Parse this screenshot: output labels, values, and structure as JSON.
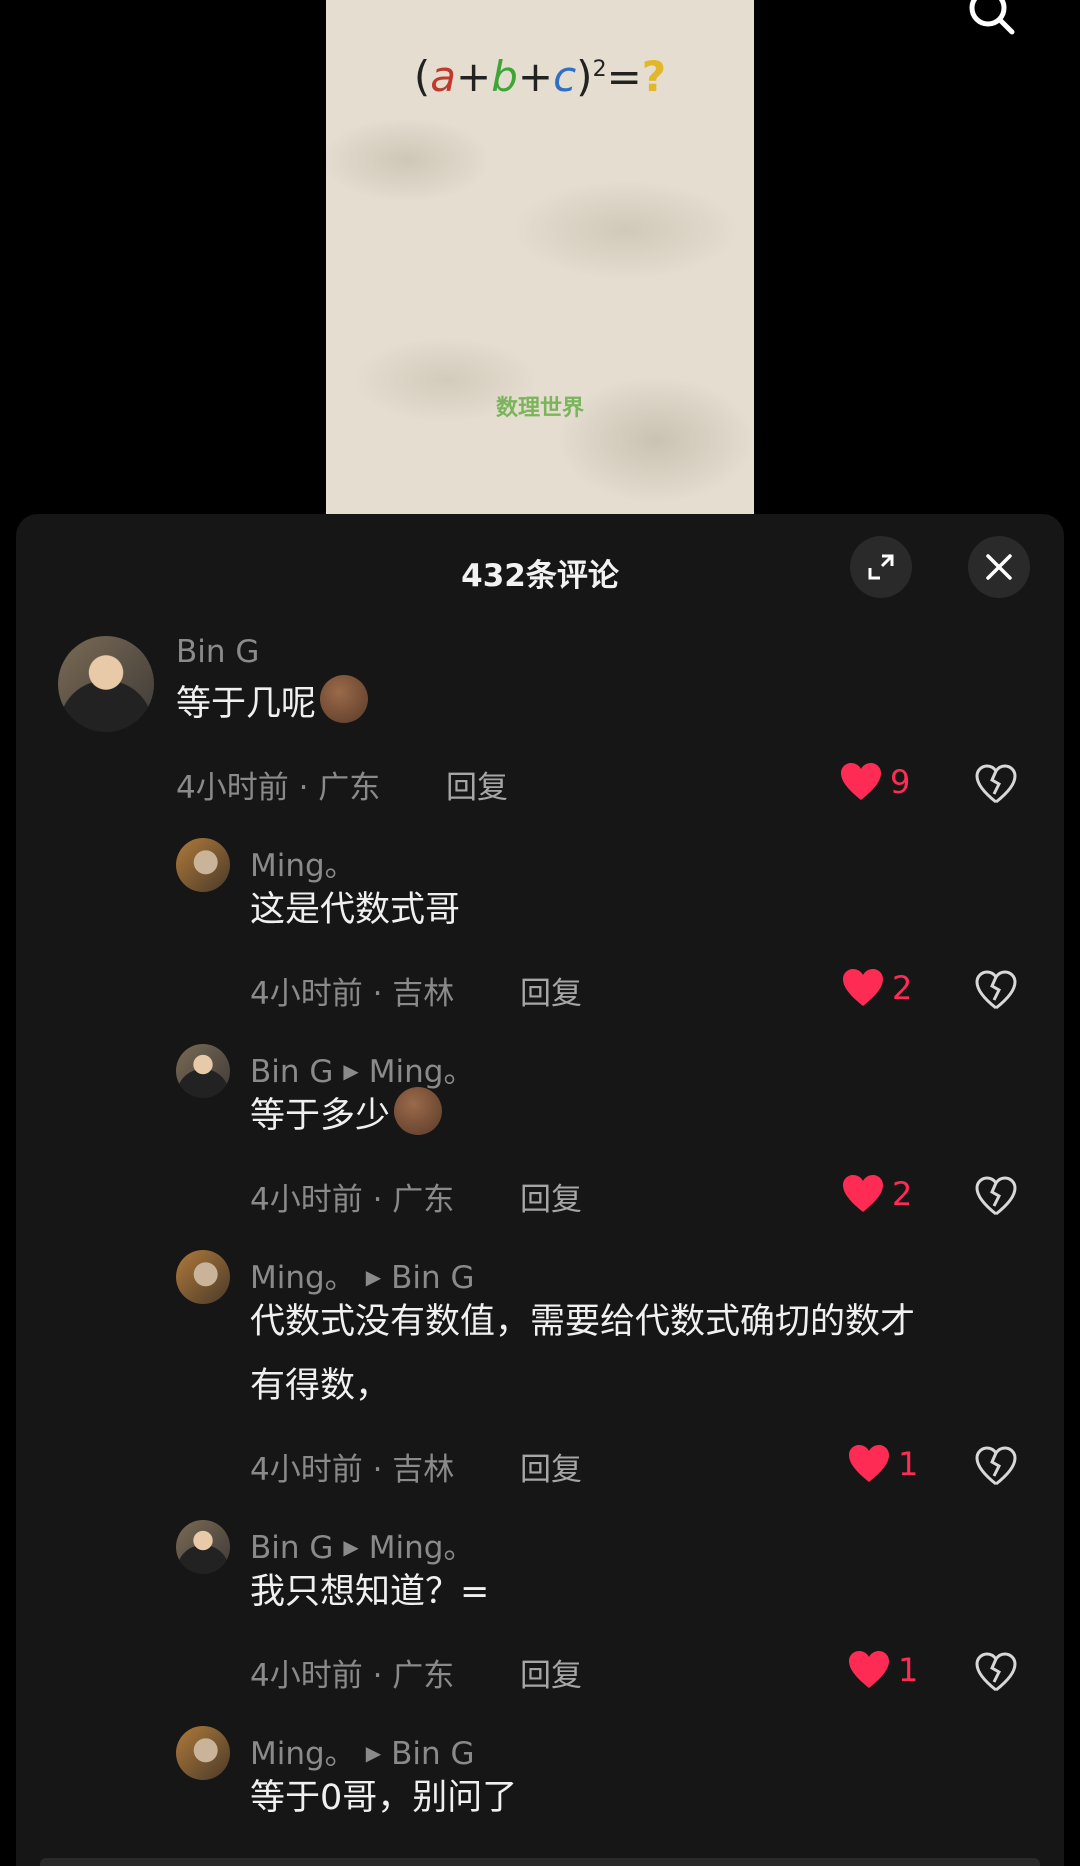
{
  "video": {
    "formula_open": "(",
    "var_a": "a",
    "plus1": "+",
    "var_b": "b",
    "plus2": "+",
    "var_c": "c",
    "formula_close": ")",
    "exponent": "2",
    "equals": "=",
    "question": "?",
    "watermark": "数理世界",
    "search_icon": "search-icon"
  },
  "sheet": {
    "title": "432条评论",
    "expand_icon": "expand-icon",
    "close_icon": "close-icon",
    "reply_label": "回复",
    "reply_arrow": "▶"
  },
  "comments": [
    {
      "user": "Bin G",
      "text": "等于几呢",
      "emoji": "smirk-emoji",
      "meta": "4小时前 · 广东",
      "likes": "9"
    },
    {
      "user": "Ming。",
      "text": "这是代数式哥",
      "meta": "4小时前 · 吉林",
      "likes": "2"
    },
    {
      "user": "Bin G",
      "reply_to": "Ming。",
      "text": "等于多少",
      "emoji": "smirk-emoji",
      "meta": "4小时前 · 广东",
      "likes": "2"
    },
    {
      "user": "Ming。",
      "reply_to": "Bin G",
      "text_line1": "代数式没有数值，需要给代数式确切的数才",
      "text_line2": "有得数，",
      "meta": "4小时前 · 吉林",
      "likes": "1"
    },
    {
      "user": "Bin G",
      "reply_to": "Ming。",
      "text": "我只想知道？=",
      "meta": "4小时前 · 广东",
      "likes": "1"
    },
    {
      "user": "Ming。",
      "reply_to": "Bin G",
      "text": "等于0哥，别问了"
    }
  ],
  "colors": {
    "like": "#fe2c55",
    "sheet_bg": "#161616",
    "muted_text": "#8a8a8a"
  }
}
